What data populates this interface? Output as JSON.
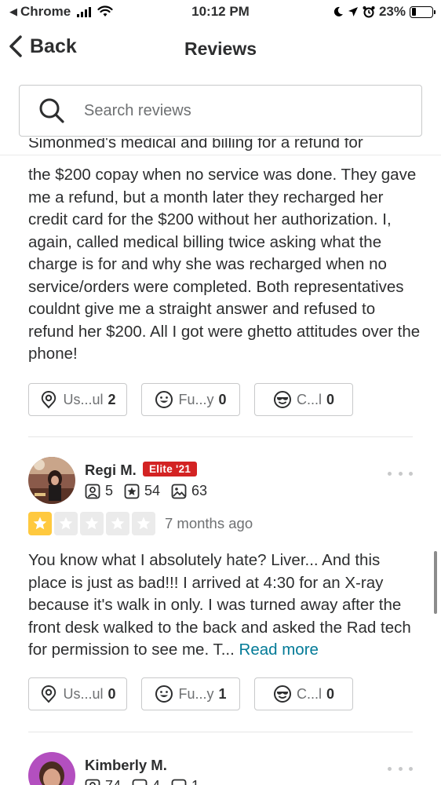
{
  "status_bar": {
    "carrier": "Chrome",
    "time": "10:12 PM",
    "battery": "23%",
    "battery_level": 0.23
  },
  "nav": {
    "back_label": "Back",
    "title": "Reviews"
  },
  "search": {
    "placeholder": "Search reviews"
  },
  "review1": {
    "cut_text": "Simonmed's medical and billing for a refund for",
    "text": "the $200 copay when no service was done. They gave me a refund, but a month later they recharged her credit card for the $200 without her authorization. I, again, called medical billing twice asking what the charge is for and why she was recharged when no service/orders were completed. Both representatives couldnt give me a straight answer and refused to refund her $200. All I got were ghetto attitudes over the phone!",
    "reactions": [
      {
        "label": "Us...ul",
        "count": "2",
        "icon": "lightbulb-icon"
      },
      {
        "label": "Fu...y",
        "count": "0",
        "icon": "smile-icon"
      },
      {
        "label": "C...l",
        "count": "0",
        "icon": "sunglasses-icon"
      }
    ]
  },
  "review2": {
    "name": "Regi M.",
    "elite": "Elite '21",
    "friends": "5",
    "reviews": "54",
    "photos": "63",
    "rating": 1,
    "date": "7 months ago",
    "text": "You know what I absolutely hate? Liver... And this place is just as bad!!! I arrived at 4:30 for an X-ray because it's walk in only. I was turned away after the front desk walked to the back and asked the Rad tech for permission to see me. T... ",
    "read_more": "Read more",
    "reactions": [
      {
        "label": "Us...ul",
        "count": "0",
        "icon": "lightbulb-icon"
      },
      {
        "label": "Fu...y",
        "count": "1",
        "icon": "smile-icon"
      },
      {
        "label": "C...l",
        "count": "0",
        "icon": "sunglasses-icon"
      }
    ]
  },
  "review3": {
    "name": "Kimberly M.",
    "friends": "74",
    "reviews": "4",
    "photos": "1"
  },
  "colors": {
    "elite": "#d32323",
    "star": "#ffc93f",
    "link": "#027a97"
  }
}
